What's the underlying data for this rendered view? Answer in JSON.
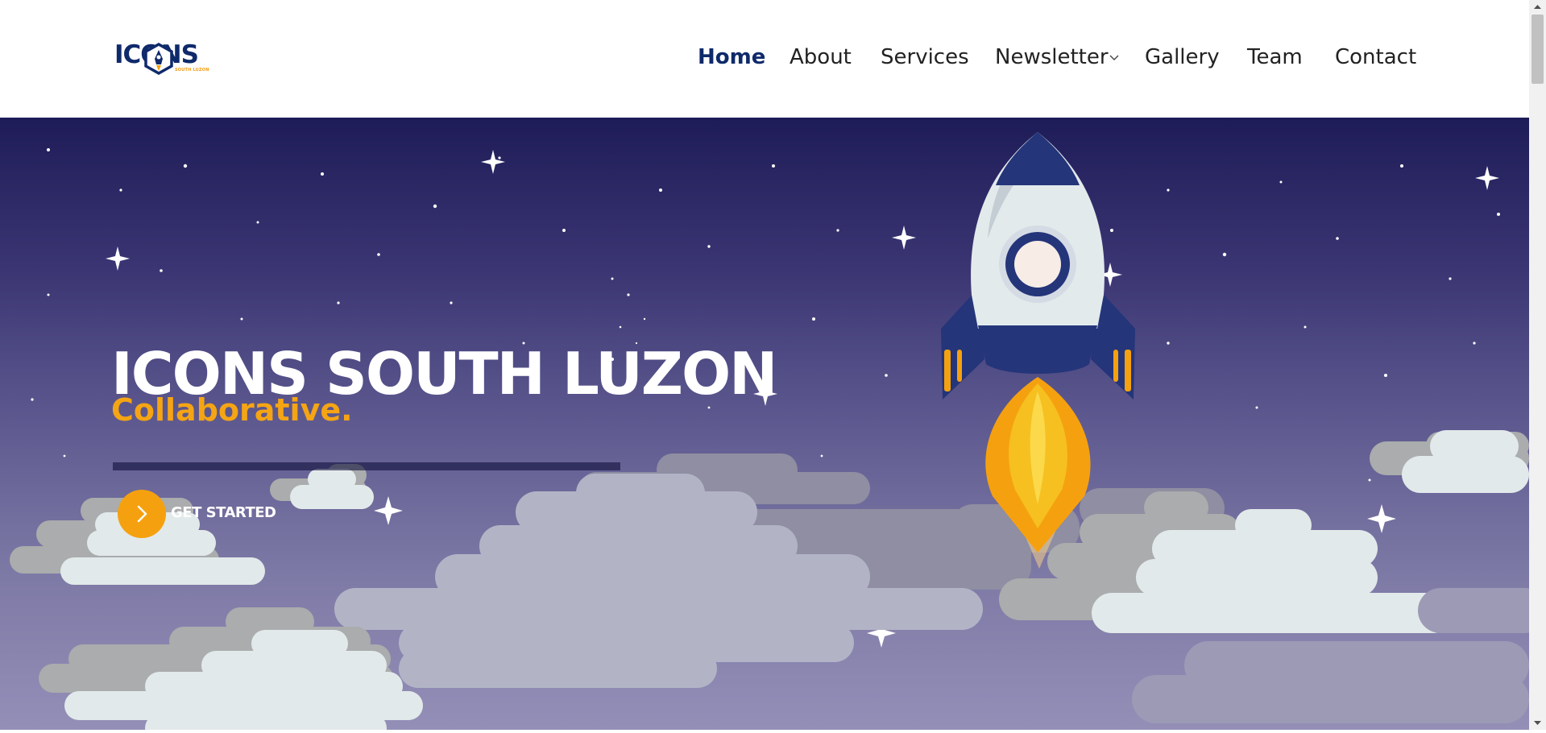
{
  "logo": {
    "text": "ICONS",
    "tagline": "SOUTH LUZON",
    "icon": "rocket-hexagon-icon"
  },
  "nav": {
    "items": [
      {
        "label": "Home",
        "active": true
      },
      {
        "label": "About"
      },
      {
        "label": "Services"
      },
      {
        "label": "Newsletter",
        "dropdown": true,
        "icon": "chevron-down-icon"
      },
      {
        "label": "Gallery"
      },
      {
        "label": "Team"
      },
      {
        "label": "Contact"
      }
    ]
  },
  "hero": {
    "title": "ICONS SOUTH LUZON",
    "subtitle": "Collaborative.",
    "cta_label": "GET STARTED",
    "cta_icon": "chevron-right-icon",
    "illustration": "rocket-launch-illustration"
  },
  "colors": {
    "brand_navy": "#0f2a6b",
    "accent_orange": "#f5a10f",
    "sky_top": "#1e1c58",
    "sky_bottom": "#948fb7"
  }
}
